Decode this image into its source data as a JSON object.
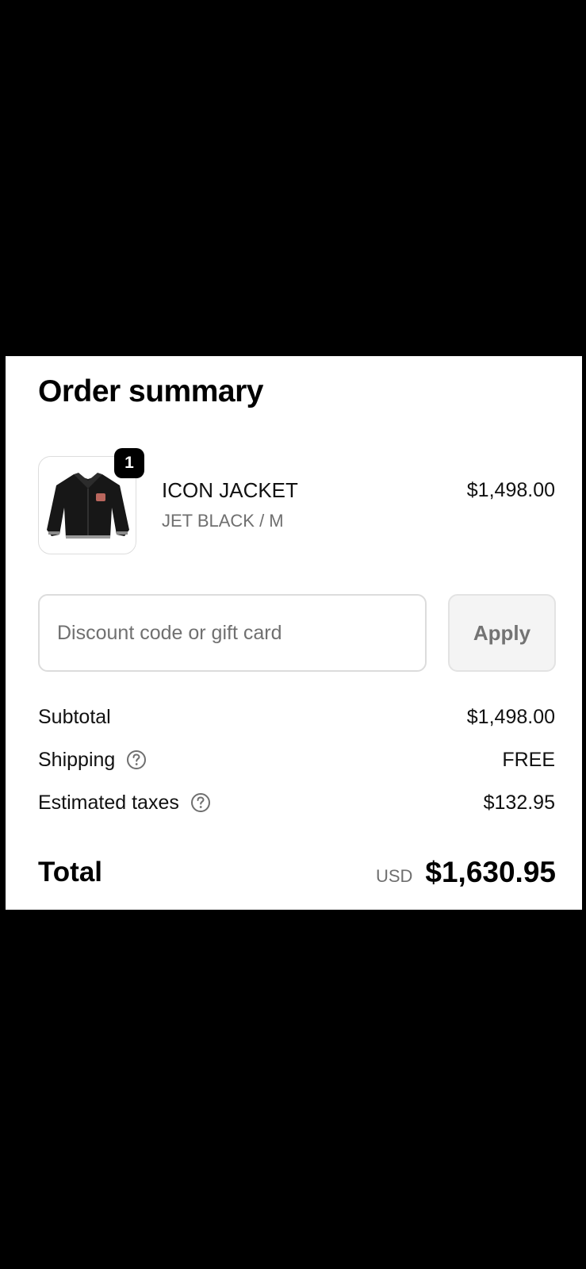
{
  "order_summary": {
    "title": "Order summary",
    "item": {
      "quantity": "1",
      "name": "ICON JACKET",
      "variant": "JET BLACK / M",
      "price": "$1,498.00",
      "image_icon": "jacket-icon"
    },
    "discount": {
      "placeholder": "Discount code or gift card",
      "value": "",
      "apply_label": "Apply"
    },
    "subtotal": {
      "label": "Subtotal",
      "value": "$1,498.00"
    },
    "shipping": {
      "label": "Shipping",
      "value": "FREE",
      "help_icon": "help-circle-icon"
    },
    "taxes": {
      "label": "Estimated taxes",
      "value": "$132.95",
      "help_icon": "help-circle-icon"
    },
    "total": {
      "label": "Total",
      "currency": "USD",
      "value": "$1,630.95"
    }
  },
  "colors": {
    "page_background": "#000000",
    "card_background": "#ffffff",
    "text_primary": "#111111",
    "text_secondary": "#6f6f6f",
    "button_background": "#f4f4f4"
  }
}
